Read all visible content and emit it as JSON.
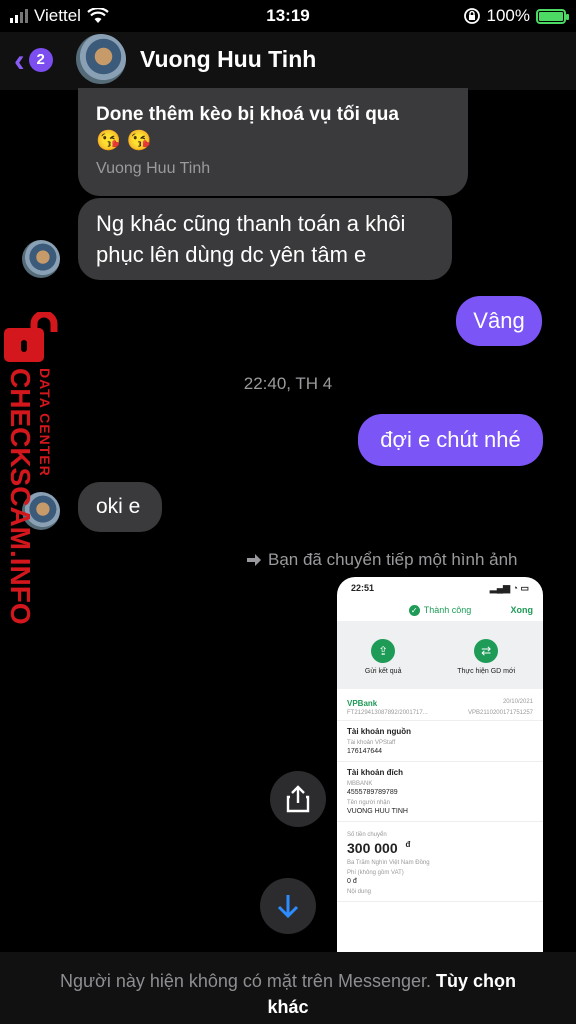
{
  "status_bar": {
    "carrier": "Viettel",
    "time": "13:19",
    "battery": "100%"
  },
  "header": {
    "back_badge": "2",
    "contact_name": "Vuong Huu Tinh"
  },
  "messages": {
    "reply_text": "Done thêm kèo bị khoá vụ tối qua",
    "reply_emoji": "😘 😘",
    "reply_from": "Vuong Huu Tinh",
    "incoming_1": "Ng khác cũng thanh toán a khôi phục lên dùng dc yên tâm e",
    "outgoing_1": "Vâng",
    "timestamp": "22:40, TH 4",
    "outgoing_2": "đợi e chút nhé",
    "incoming_2": "oki e",
    "forward_note": "Bạn đã chuyển tiếp một hình ảnh"
  },
  "forwarded_image": {
    "time": "22:51",
    "status": "Thành công",
    "done": "Xong",
    "action_send": "Gửi kết quả",
    "action_repeat": "Thực hiện GD mới",
    "bank": "VPBank",
    "date": "20/10/2021",
    "ref_left": "FT2129413087892/2001717...",
    "ref_right": "VPB2110200171751257",
    "source_heading": "Tài khoản nguồn",
    "source_label": "Tài khoản VPStaff",
    "source_value": "176147644",
    "dest_heading": "Tài khoản đích",
    "dest_bank": "MBBANK",
    "dest_account": "4555789789789",
    "recipient_label": "Tên người nhận",
    "recipient_value": "VUONG HUU TINH",
    "amount_label": "Số tiền chuyển",
    "amount_value": "300 000",
    "currency": "đ",
    "amount_words": "Ba Trăm Nghìn Việt Nam Đồng",
    "fee_label": "Phí (không gồm VAT)",
    "fee_value": "0 đ",
    "content_label": "Nội dung"
  },
  "footer": {
    "notice": "Người này hiện không có mặt trên Messenger.",
    "link": "Tùy chọn khác"
  },
  "watermark": {
    "brand": "CHECKSCAM.INFO",
    "sub": "DATA CENTER"
  },
  "colors": {
    "accent": "#7b55f5",
    "incoming_bubble": "#3a3a3c",
    "watermark_red": "#d4171c",
    "success_green": "#1e9b57"
  }
}
